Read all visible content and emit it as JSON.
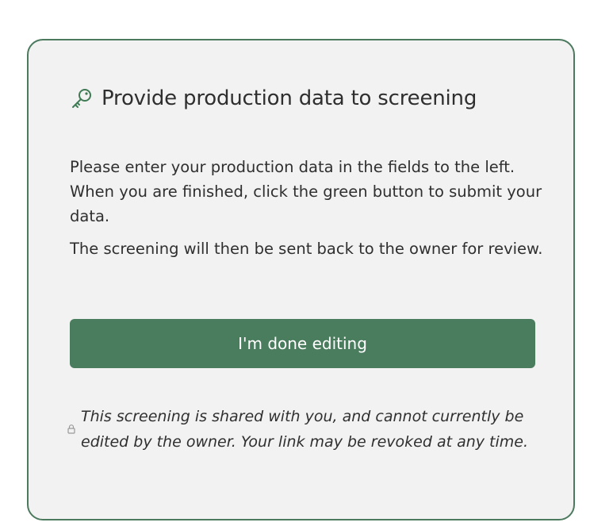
{
  "card": {
    "title": "Provide production data to screening",
    "title_icon": "key-icon",
    "paragraphs": [
      "Please enter your production data in the fields to the left. When you are finished, click the green button to submit your data.",
      "The screening will then be sent back to the owner for review."
    ],
    "button_label": "I'm done editing",
    "note_icon": "lock-icon",
    "note": "This screening is shared with you, and cannot currently be edited by the owner. Your link may be revoked at any time."
  },
  "colors": {
    "accent": "#4a7d5e",
    "card_border": "#4b7a5e",
    "card_background": "#f2f2f2",
    "text": "#2f2f2f"
  }
}
